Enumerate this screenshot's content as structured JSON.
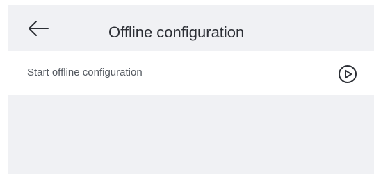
{
  "header": {
    "title": "Offline configuration",
    "back_icon": "arrow-left-icon"
  },
  "rows": [
    {
      "label": "Start offline configuration",
      "icon": "play-circle-icon"
    }
  ],
  "colors": {
    "panel_background": "#f0f1f4",
    "row_background": "#ffffff",
    "title_text": "#2c2f35",
    "row_text": "#555a61",
    "icon": "#2c2f35"
  }
}
